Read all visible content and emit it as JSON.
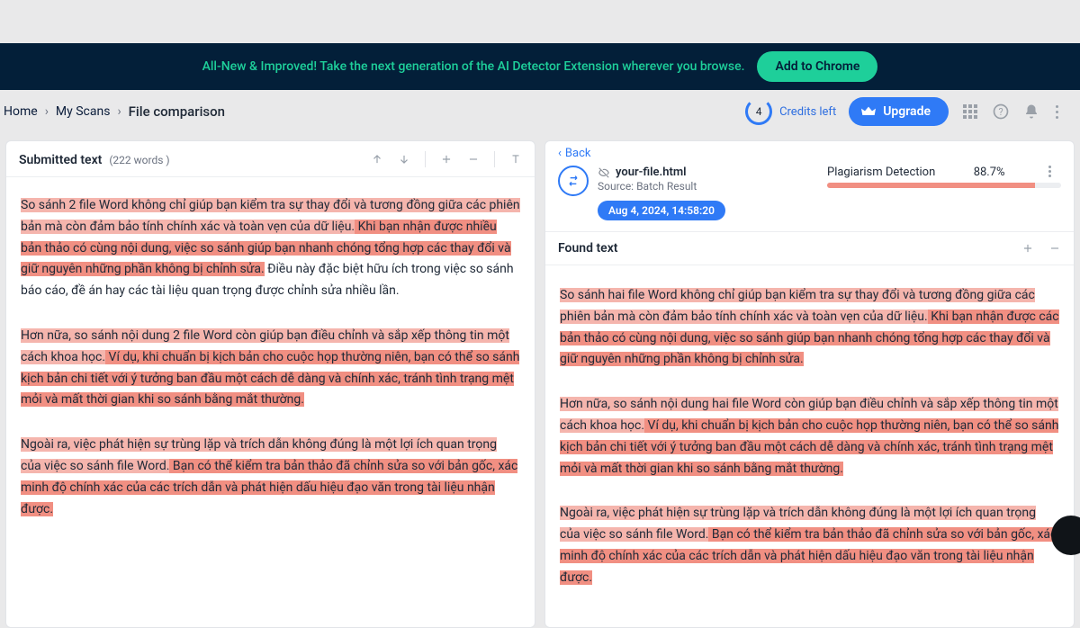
{
  "banner": {
    "text": "All-New & Improved! Take the next generation of the AI Detector Extension wherever you browse.",
    "cta": "Add to Chrome"
  },
  "breadcrumbs": {
    "home": "Home",
    "scans": "My Scans",
    "current": "File comparison"
  },
  "credits": {
    "count": "4",
    "label": "Credits left"
  },
  "upgrade_label": "Upgrade",
  "left": {
    "title": "Submitted text",
    "word_count": "(222 words )",
    "p1a": "So sánh 2 file Word không chỉ giúp bạn kiểm tra sự thay đổi và tương đồng giữa các phiên bản mà còn đảm bảo tính chính xác và toàn vẹn của dữ liệu.",
    "p1b": " Khi bạn nhận được nhiều bản thảo có cùng nội dung, việc so sánh giúp bạn nhanh chóng tổng hợp các thay đổi và giữ nguyên những phần không bị chỉnh sửa.",
    "p1c": " Điều này đặc biệt hữu ích trong việc so sánh báo cáo, đề án hay các tài liệu quan trọng được chỉnh sửa nhiều lần.",
    "p2a": "Hơn nữa, so sánh nội dung 2 file Word còn giúp bạn điều chỉnh và sắp xếp thông tin một cách khoa học.",
    "p2b": " Ví dụ, khi chuẩn bị kịch bản cho cuộc họp thường niên, bạn có thể so sánh kịch bản chi tiết với ý tưởng ban đầu một cách dễ dàng và chính xác, tránh tình trạng mệt mỏi và mất thời gian khi so sánh bằng mắt thường.",
    "p3a": "Ngoài ra, việc phát hiện sự trùng lặp và trích dẫn không đúng là một lợi ích quan trọng của việc so sánh file Word.",
    "p3b": " Bạn có thể kiểm tra bản thảo đã chỉnh sửa so với bản gốc, xác minh độ chính xác của các trích dẫn và phát hiện dấu hiệu đạo văn trong tài liệu nhận được."
  },
  "right": {
    "back": "Back",
    "filename": "your-file.html",
    "source": "Source: Batch Result",
    "date": "Aug 4, 2024, 14:58:20",
    "detect_label": "Plagiarism Detection",
    "detect_value": "88.7%",
    "detect_fill": "88.7%",
    "found_title": "Found text",
    "p1a": "So sánh hai file Word không chỉ giúp bạn kiểm tra sự thay đổi và tương đồng giữa các phiên bản mà còn đảm bảo tính chính xác và toàn vẹn của dữ liệu.",
    "p1b": " Khi bạn nhận được các bản thảo có cùng nội dung, việc so sánh giúp bạn nhanh chóng tổng hợp các thay đổi và giữ nguyên những phần không bị chỉnh sửa.",
    "p2a": "Hơn nữa, so sánh nội dung hai file Word còn giúp bạn điều chỉnh và sắp xếp thông tin một cách khoa học.",
    "p2b": " Ví dụ, khi chuẩn bị kịch bản cho cuộc họp thường niên, bạn có thể so sánh kịch bản chi tiết với ý tưởng ban đầu một cách dễ dàng và chính xác, tránh tình trạng mệt mỏi và mất thời gian khi so sánh bằng mắt thường.",
    "p3a": "Ngoài ra, việc phát hiện sự trùng lặp và trích dẫn không đúng là một lợi ích quan trọng của việc so sánh file Word.",
    "p3b": " Bạn có thể kiểm tra bản thảo đã chỉnh sửa so với bản gốc, xác minh độ chính xác của các trích dẫn và phát hiện dấu hiệu đạo văn trong tài liệu nhận được."
  }
}
